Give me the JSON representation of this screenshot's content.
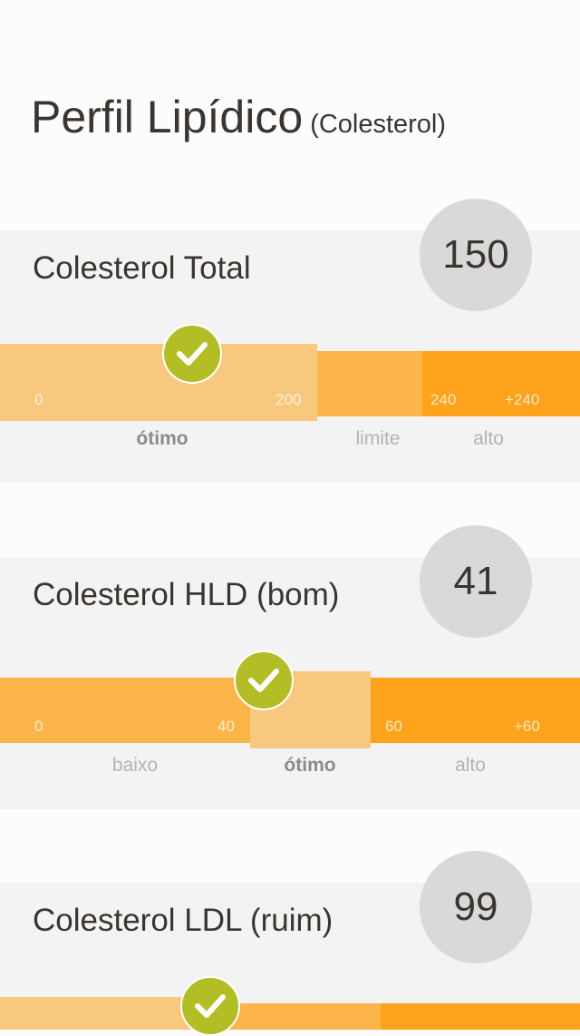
{
  "header": {
    "title": "Perfil Lipídico",
    "subtitle": "(Colesterol)"
  },
  "colors": {
    "card_bg": "#f3f3f3",
    "light_zone": "#f8c87f",
    "mid_zone": "#fbb548",
    "dark_zone": "#fea31b",
    "check_green": "#b3bd25",
    "circle_gray": "#d9d9d9"
  },
  "cards": [
    {
      "label": "Colesterol Total",
      "value": "150",
      "ticks": [
        "0",
        "200",
        "240",
        "+240"
      ],
      "zones": [
        "ótimo",
        "limite",
        "alto"
      ],
      "active_zone": "ótimo"
    },
    {
      "label": "Colesterol HLD (bom)",
      "value": "41",
      "ticks": [
        "0",
        "40",
        "60",
        "+60"
      ],
      "zones": [
        "baixo",
        "ótimo",
        "alto"
      ],
      "active_zone": "ótimo"
    },
    {
      "label": "Colesterol LDL (ruim)",
      "value": "99"
    }
  ]
}
